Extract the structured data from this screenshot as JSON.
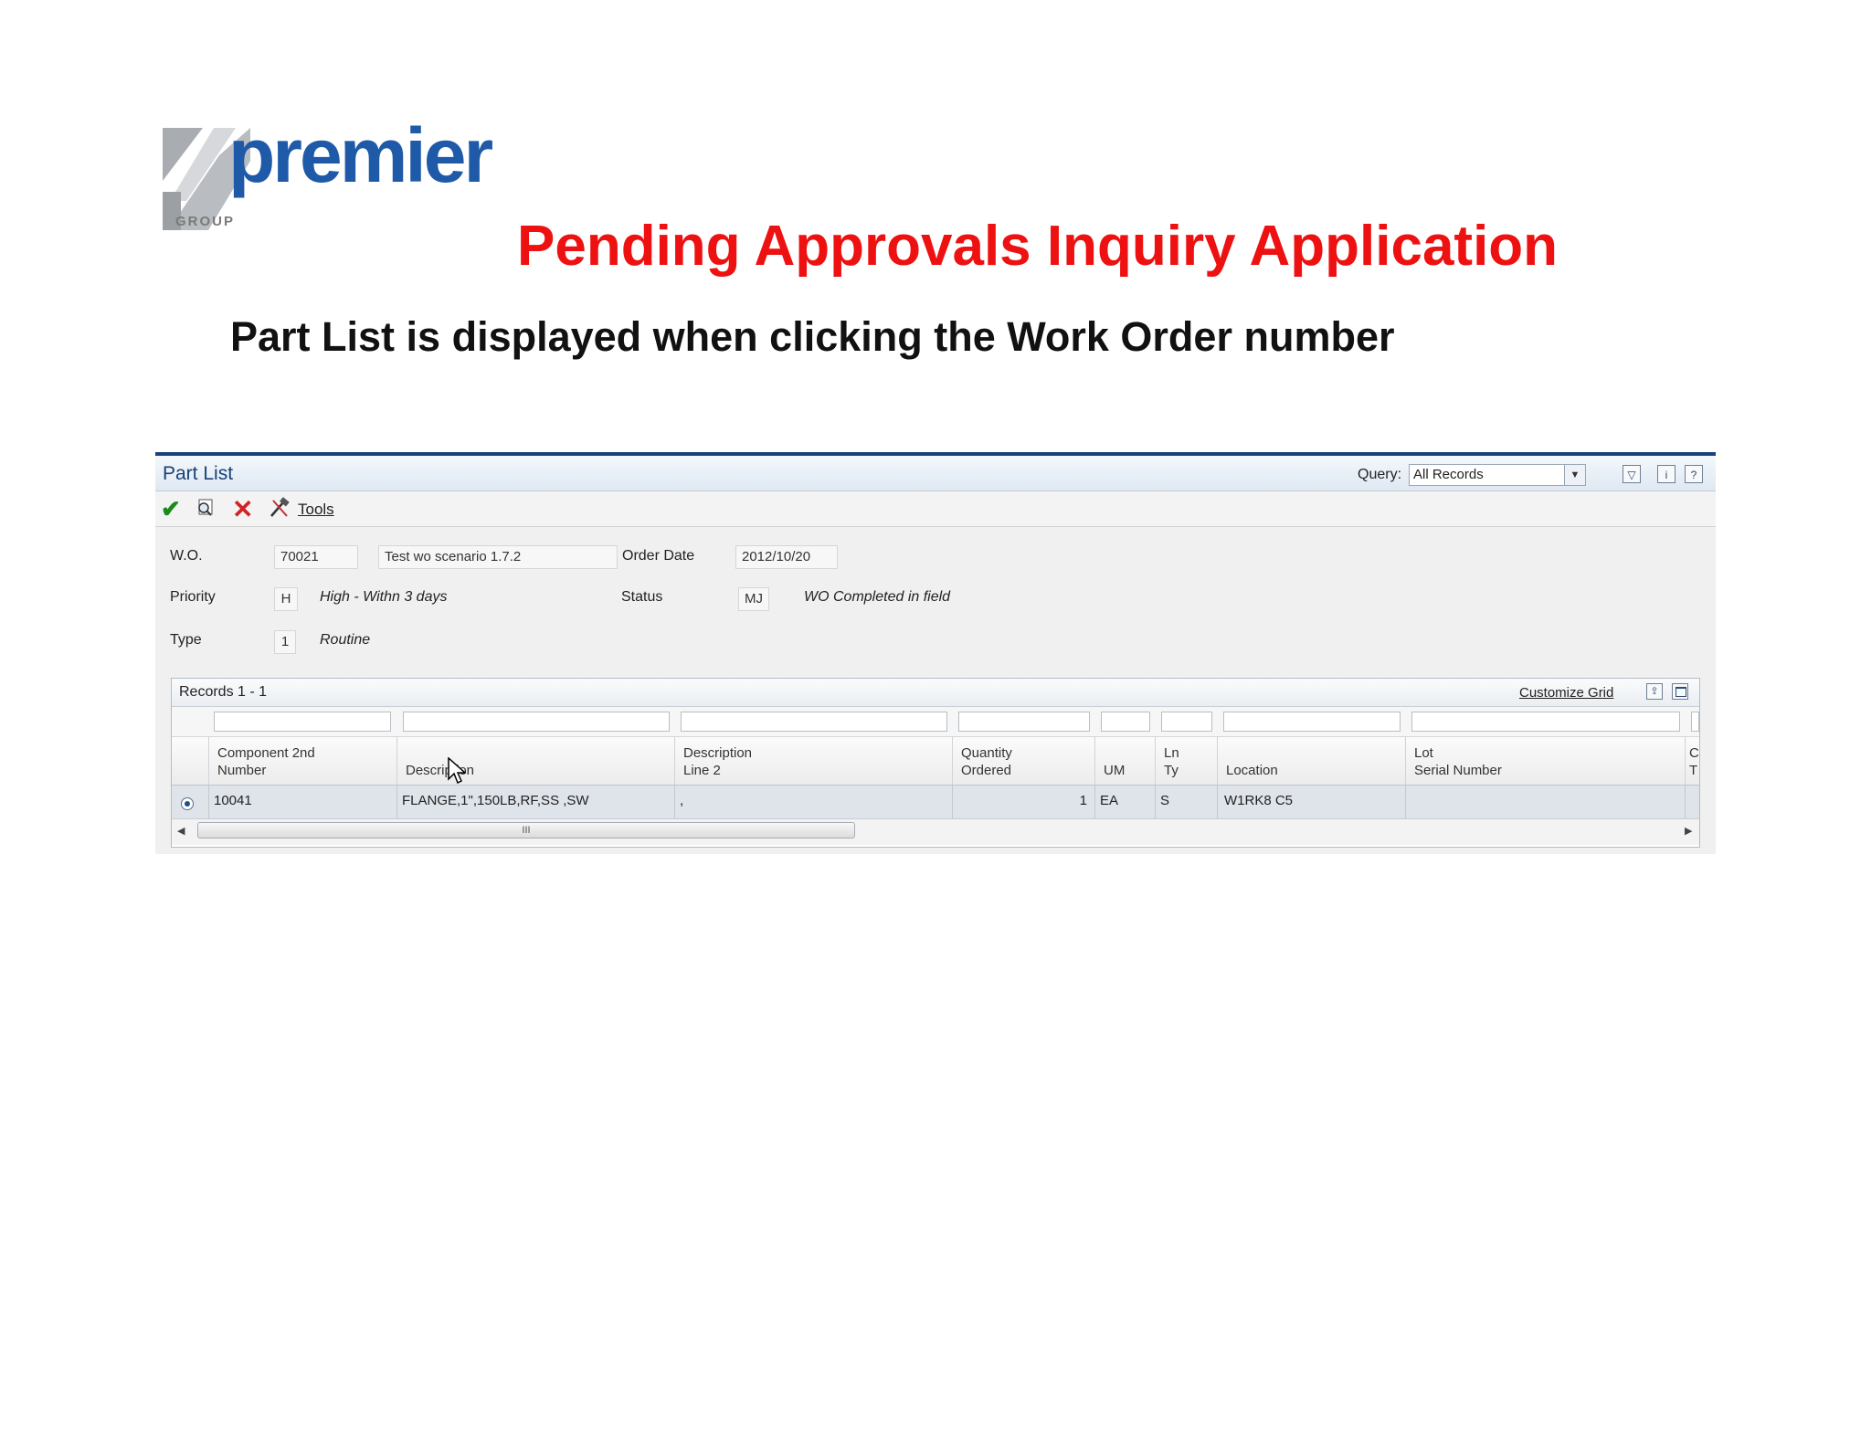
{
  "logo": {
    "word": "premier",
    "sub": "GROUP"
  },
  "slide": {
    "title": "Pending Approvals Inquiry Application",
    "subtitle": "Part List is displayed when clicking the Work Order number"
  },
  "form": {
    "title": "Part List",
    "query_label": "Query:",
    "query_value": "All Records",
    "toolbar": {
      "tools_label": "Tools"
    },
    "fields": {
      "wo_label": "W.O.",
      "wo_number": "70021",
      "wo_description": "Test wo scenario 1.7.2",
      "order_date_label": "Order Date",
      "order_date": "2012/10/20",
      "priority_label": "Priority",
      "priority_code": "H",
      "priority_desc": "High - Withn 3 days",
      "status_label": "Status",
      "status_code": "MJ",
      "status_desc": "WO Completed in field",
      "type_label": "Type",
      "type_code": "1",
      "type_desc": "Routine"
    },
    "grid": {
      "records_label": "Records 1 - 1",
      "customize_label": "Customize Grid",
      "columns": [
        {
          "line1": "Component 2nd",
          "line2": "Number"
        },
        {
          "line1": "",
          "line2": "Description"
        },
        {
          "line1": "Description",
          "line2": "Line 2"
        },
        {
          "line1": "Quantity",
          "line2": "Ordered"
        },
        {
          "line1": "",
          "line2": "UM"
        },
        {
          "line1": "Ln",
          "line2": "Ty"
        },
        {
          "line1": "",
          "line2": "Location"
        },
        {
          "line1": "Lot",
          "line2": "Serial Number"
        },
        {
          "line1": "C",
          "line2": "T"
        }
      ],
      "rows": [
        [
          "10041",
          "FLANGE,1\",150LB,RF,SS ,SW",
          ",",
          "1",
          "EA",
          "S",
          "W1RK8 C5",
          "",
          ""
        ]
      ],
      "scroll_grip": "III"
    }
  }
}
